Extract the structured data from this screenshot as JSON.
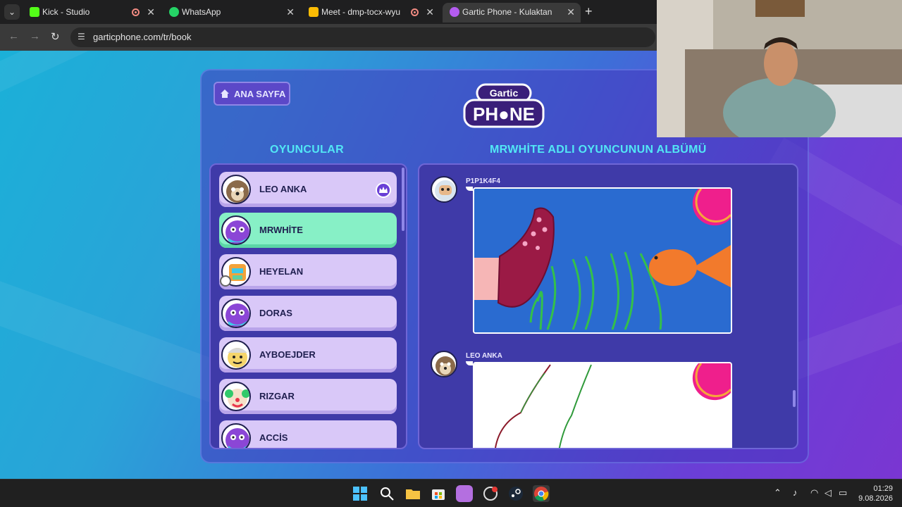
{
  "browser": {
    "tabs": [
      {
        "title": "Kick - Studio",
        "recording": true,
        "active": false
      },
      {
        "title": "WhatsApp",
        "recording": false,
        "active": false
      },
      {
        "title": "Meet - dmp-tocx-wyu",
        "recording": true,
        "active": false
      },
      {
        "title": "Gartic Phone - Kulaktan Kulağa",
        "recording": false,
        "active": true
      }
    ],
    "new_tab": "+",
    "url": "garticphone.com/tr/book"
  },
  "page": {
    "home_button": "ANA SAYFA",
    "logo_top": "Gartic",
    "logo_bottom": "PH●NE",
    "players_heading": "OYUNCULAR",
    "album_heading": "MRWHİTE ADLI OYUNCUNUN ALBÜMÜ"
  },
  "players": [
    {
      "name": "LEO ANKA",
      "host": true,
      "selected": false,
      "avatar": "dog-avatar-icon"
    },
    {
      "name": "MRWHİTE",
      "host": false,
      "selected": true,
      "avatar": "purple-bird-avatar-icon"
    },
    {
      "name": "HEYELAN",
      "host": false,
      "selected": false,
      "avatar": "robot-avatar-icon"
    },
    {
      "name": "DORAS",
      "host": false,
      "selected": false,
      "avatar": "purple-bird-avatar-icon"
    },
    {
      "name": "AYBOEJDER",
      "host": false,
      "selected": false,
      "avatar": "viking-avatar-icon"
    },
    {
      "name": "RIZGAR",
      "host": false,
      "selected": false,
      "avatar": "clown-avatar-icon"
    },
    {
      "name": "ACCİS",
      "host": false,
      "selected": false,
      "avatar": "purple-bird-avatar-icon"
    }
  ],
  "album": [
    {
      "author": "P1P1K4F4",
      "avatar": "astronaut-avatar-icon",
      "drawing": "sock-and-fish-drawing"
    },
    {
      "author": "LEO ANKA",
      "avatar": "dog-avatar-icon",
      "drawing": "outline-drawing"
    }
  ],
  "taskbar": {
    "time": "01:29",
    "date": "9.08.2026"
  },
  "colors": {
    "accent_heading": "#52e7f5",
    "selected_player": "#87f0c6",
    "player_card": "#d9c8f8",
    "panel": "#3f3aa8"
  }
}
